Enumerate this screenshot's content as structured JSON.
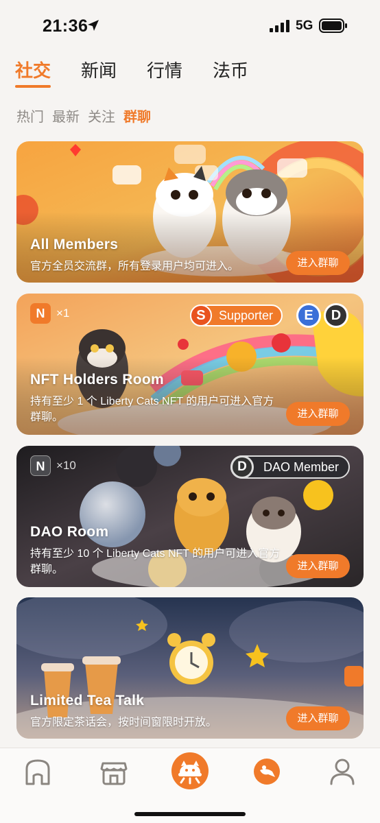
{
  "status_bar": {
    "time": "21:36",
    "network": "5G"
  },
  "main_tabs": [
    {
      "label": "社交",
      "active": true
    },
    {
      "label": "新闻",
      "active": false
    },
    {
      "label": "行情",
      "active": false
    },
    {
      "label": "法币",
      "active": false
    }
  ],
  "sub_tabs": [
    {
      "label": "热门",
      "active": false
    },
    {
      "label": "最新",
      "active": false
    },
    {
      "label": "关注",
      "active": false
    },
    {
      "label": "群聊",
      "active": true
    }
  ],
  "rooms": [
    {
      "title": "All Members",
      "description": "官方全员交流群，所有登录用户均可进入。",
      "button": "进入群聊"
    },
    {
      "title": "NFT Holders Room",
      "description": "持有至少 1 个 Liberty Cats NFT 的用户可进入官方群聊。",
      "button": "进入群聊",
      "nft_badge": "N",
      "nft_count": "×1",
      "supporter_letter": "S",
      "supporter_label": "Supporter",
      "level_e": "E",
      "level_d": "D"
    },
    {
      "title": "DAO Room",
      "description": "持有至少 10 个 Liberty Cats NFT 的用户可进入官方群聊。",
      "button": "进入群聊",
      "nft_badge": "N",
      "nft_count": "×10",
      "dao_letter": "D",
      "dao_label": "DAO Member"
    },
    {
      "title": "Limited Tea Talk",
      "description": "官方限定茶话会，按时间窗限时开放。",
      "button": "进入群聊"
    }
  ],
  "tab_bar": [
    {
      "icon": "home-icon",
      "active": false
    },
    {
      "icon": "store-icon",
      "active": false
    },
    {
      "icon": "cat-center-icon",
      "active": true
    },
    {
      "icon": "chat-planet-icon",
      "active": false
    },
    {
      "icon": "profile-icon",
      "active": false
    }
  ],
  "colors": {
    "accent": "#f07a2a",
    "background": "#f6f4f2"
  }
}
